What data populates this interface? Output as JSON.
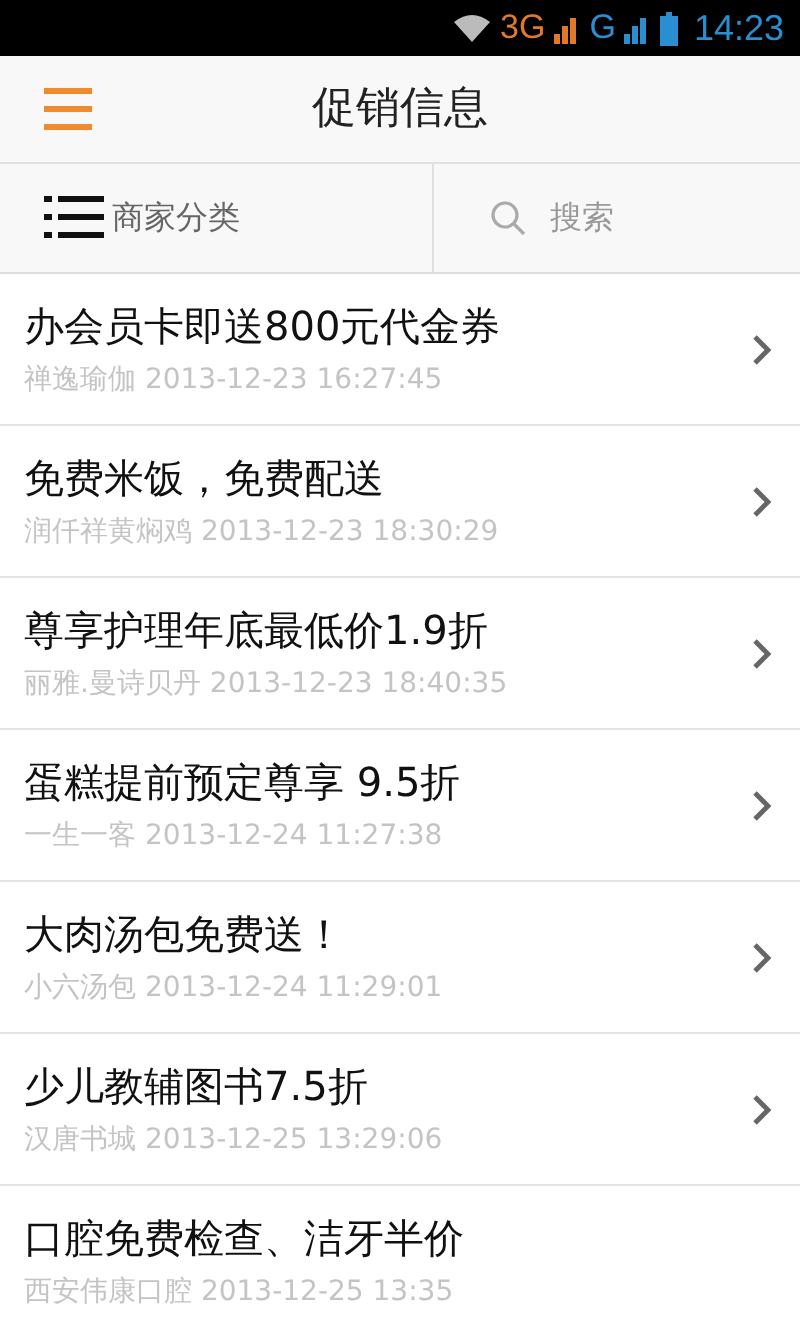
{
  "status_bar": {
    "network_1": "3G",
    "network_2": "G",
    "time": "14:23"
  },
  "header": {
    "title": "促销信息"
  },
  "toolbar": {
    "category": "商家分类",
    "search": {
      "placeholder": "搜索"
    }
  },
  "promotions": [
    {
      "title": "办会员卡即送800元代金券",
      "merchant": "禅逸瑜伽",
      "time": "2013-12-23 16:27:45",
      "arrow": true
    },
    {
      "title": "免费米饭，免费配送",
      "merchant": "润仟祥黄焖鸡",
      "time": "2013-12-23 18:30:29",
      "arrow": true
    },
    {
      "title": "尊享护理年底最低价1.9折",
      "merchant": "丽雅.曼诗贝丹",
      "time": "2013-12-23 18:40:35",
      "arrow": true
    },
    {
      "title": "蛋糕提前预定尊享 9.5折",
      "merchant": "一生一客",
      "time": "2013-12-24 11:27:38",
      "arrow": true
    },
    {
      "title": "大肉汤包免费送！",
      "merchant": "小六汤包",
      "time": "2013-12-24 11:29:01",
      "arrow": true
    },
    {
      "title": "少儿教辅图书7.5折",
      "merchant": "汉唐书城",
      "time": "2013-12-25 13:29:06",
      "arrow": true
    },
    {
      "title": "口腔免费检查、洁牙半价",
      "merchant": "西安伟康口腔",
      "time": "2013-12-25 13:35",
      "arrow": false
    }
  ]
}
